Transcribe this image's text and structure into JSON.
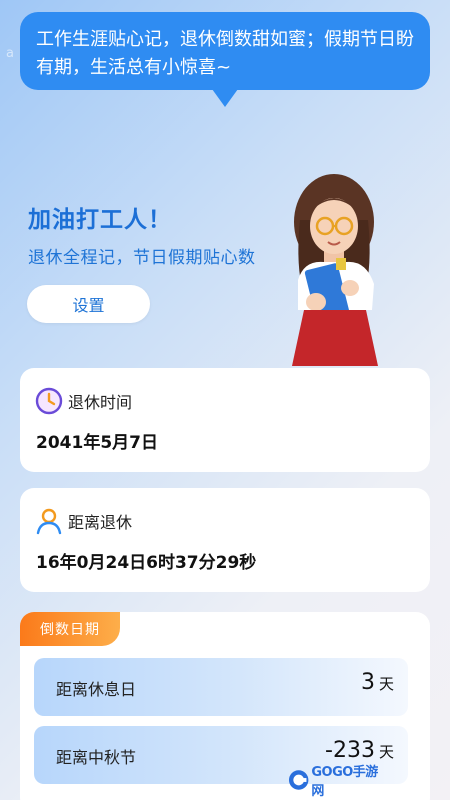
{
  "watermark": "a",
  "bubble": {
    "text": "工作生涯贴心记，退休倒数甜如蜜；假期节日盼有期，生活总有小惊喜~"
  },
  "hero": {
    "title": "加油打工人！",
    "subtitle": "退休全程记，节日假期贴心数",
    "settings_label": "设置"
  },
  "retire_time": {
    "icon": "clock-icon",
    "label": "退休时间",
    "value": "2041年5月7日"
  },
  "until_retire": {
    "icon": "person-icon",
    "label": "距离退休",
    "value": "16年0月24日6时37分29秒"
  },
  "countdown": {
    "tag": "倒数日期",
    "items": [
      {
        "label": "距离休息日",
        "value": "3",
        "unit": "天"
      },
      {
        "label": "距离中秋节",
        "value": "-233",
        "unit": "天"
      }
    ]
  },
  "logo": {
    "text": "GOGO手游网"
  },
  "colors": {
    "accent": "#2f8cf2",
    "title_blue": "#1c6fd6",
    "tag_orange": "#fb7a1a"
  }
}
